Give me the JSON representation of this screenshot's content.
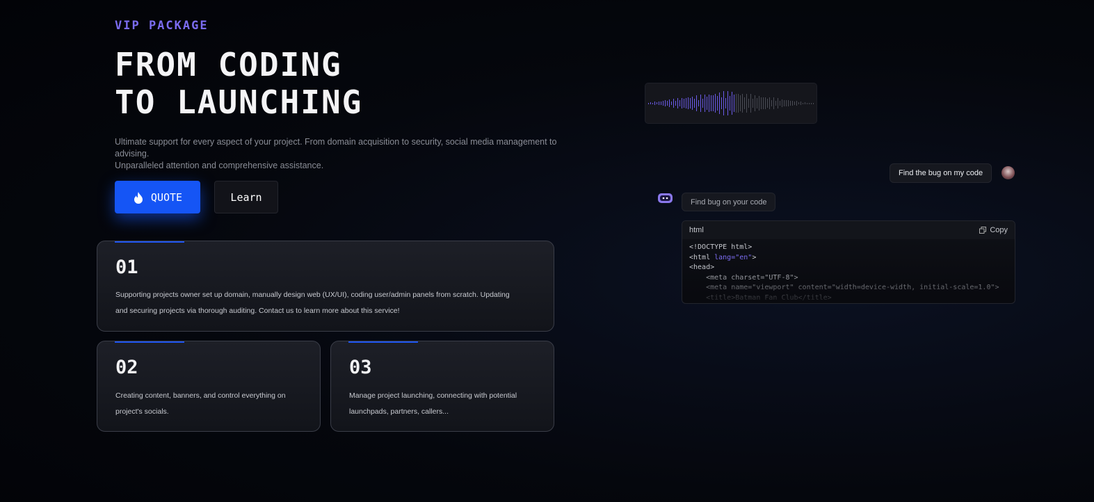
{
  "hero": {
    "eyebrow": "VIP PACKAGE",
    "title_line1": "From Coding",
    "title_line2": "To Launching",
    "subtitle_line1": "Ultimate support for every aspect of your project. From domain acquisition to security, social media management to advising.",
    "subtitle_line2": "Unparalleled attention and comprehensive assistance.",
    "quote_label": "QUOTE",
    "learn_label": "Learn"
  },
  "cards": [
    {
      "number": "01",
      "text_line1": "Supporting projects owner set up domain, manually design web (UX/UI), coding user/admin panels from scratch. Updating",
      "text_line2": "and securing projects via thorough auditing. Contact us to learn more about this service!"
    },
    {
      "number": "02",
      "text_line1": "Creating content, banners, and control everything on",
      "text_line2": "project's socials."
    },
    {
      "number": "03",
      "text_line1": "Manage project launching, connecting with potential",
      "text_line2": "launchpads, partners, callers..."
    }
  ],
  "chat": {
    "user_message": "Find the bug on my code",
    "bot_message": "Find bug on your code",
    "code_lang": "html",
    "copy_label": "Copy",
    "code_lines": [
      "<!DOCTYPE html>",
      "<html lang=\"en\">",
      "<head>",
      "    <meta charset=\"UTF-8\">",
      "    <meta name=\"viewport\" content=\"width=device-width, initial-scale=1.0\">",
      "    <title>Batman Fan Club</title>"
    ]
  },
  "colors": {
    "accent": "#1555f5",
    "purple": "#7b6cf0",
    "background": "#05070d"
  }
}
